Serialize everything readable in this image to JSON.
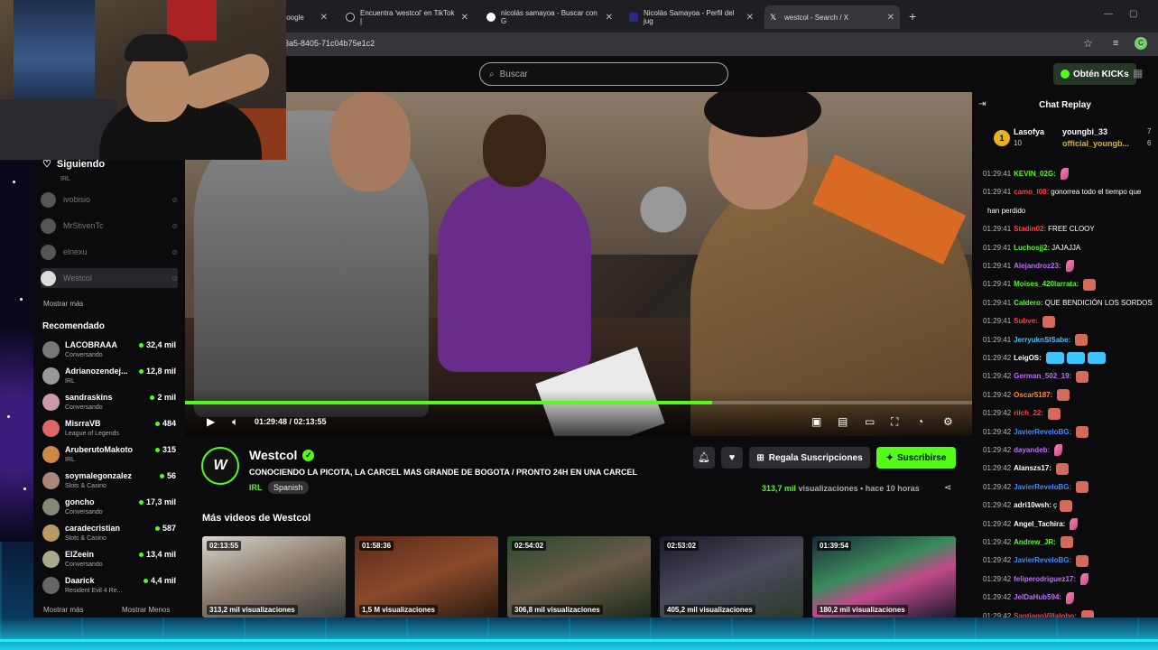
{
  "browser": {
    "tabs": [
      {
        "label": "Google",
        "close": "✕"
      },
      {
        "label": "Encuentra 'westcol' en TikTok |",
        "close": "✕"
      },
      {
        "label": "nicolás samayoa - Buscar con G",
        "close": "✕"
      },
      {
        "label": "Nicolás Samayoa - Perfil del jug",
        "close": "✕"
      },
      {
        "label": "westcol - Search / X",
        "close": "✕"
      }
    ],
    "new_tab": "+",
    "url": "3a5-8405-71c04b75e1c2",
    "profile_initial": "C"
  },
  "nav": {
    "search_placeholder": "Buscar",
    "kicks_label": "Obtén KICKs"
  },
  "sidebar": {
    "following_title": "Siguiendo",
    "following_sub": "IRL",
    "following": [
      {
        "name": "ivobisio"
      },
      {
        "name": "MrStivenTc"
      },
      {
        "name": "elnexu"
      },
      {
        "name": "Westcol"
      }
    ],
    "show_more": "Mostrar más",
    "recommended_title": "Recomendado",
    "recommended": [
      {
        "name": "LACOBRAAA",
        "category": "Conversando",
        "viewers": "32,4 mil"
      },
      {
        "name": "Adrianozendej...",
        "category": "IRL",
        "viewers": "12,8 mil"
      },
      {
        "name": "sandraskins",
        "category": "Conversando",
        "viewers": "2 mil"
      },
      {
        "name": "MisrraVB",
        "category": "League of Legends",
        "viewers": "484"
      },
      {
        "name": "AruberutoMakoto",
        "category": "IRL",
        "viewers": "315"
      },
      {
        "name": "soymalegonzalez",
        "category": "Slots & Casino",
        "viewers": "56"
      },
      {
        "name": "goncho",
        "category": "Conversando",
        "viewers": "17,3 mil"
      },
      {
        "name": "caradecristian",
        "category": "Slots & Casino",
        "viewers": "587"
      },
      {
        "name": "ElZeein",
        "category": "Conversando",
        "viewers": "13,4 mil"
      },
      {
        "name": "Daarick",
        "category": "Resident Evil 4 Re...",
        "viewers": "4,4 mil"
      }
    ],
    "footer_more": "Mostrar más",
    "footer_less": "Mostrar Menos"
  },
  "player": {
    "progress": 0.67,
    "time": "01:29:48 / 02:13:55"
  },
  "stream": {
    "channel": "Westcol",
    "avatar_text": "W",
    "title": "CONOCIENDO LA PICOTA, LA CARCEL MAS GRANDE DE BOGOTA / PRONTO 24H EN UNA CARCEL",
    "category": "IRL",
    "tag": "Spanish",
    "gift_label": "Regala Suscripciones",
    "subscribe_label": "Suscribirse",
    "views_count": "313,7 mil",
    "views_word": "visualizaciones",
    "ago": "hace 10 horas",
    "more_videos_title": "Más videos de Westcol",
    "videos": [
      {
        "duration": "02:13:55",
        "views": "313,2 mil visualizaciones"
      },
      {
        "duration": "01:58:36",
        "views": "1,5 M visualizaciones"
      },
      {
        "duration": "02:54:02",
        "views": "306,8 mil visualizaciones"
      },
      {
        "duration": "02:53:02",
        "views": "405,2 mil visualizaciones"
      },
      {
        "duration": "01:39:54",
        "views": "180,2 mil visualizaciones"
      }
    ]
  },
  "chat": {
    "title": "Chat Replay",
    "pinned": [
      {
        "name": "Lasofya",
        "count": "10"
      },
      {
        "name": "youngbi_33",
        "count": "7"
      },
      {
        "name": "official_youngb...",
        "count": "6"
      }
    ],
    "messages": [
      {
        "time": "01:29:41",
        "user": "KEVIN_02G:",
        "text": "",
        "color": "#53fc18"
      },
      {
        "time": "01:29:41",
        "user": "camo_l08:",
        "text": "gonorrea todo el tiempo que",
        "color": "#ff4040"
      },
      {
        "time": "",
        "user": "",
        "text": "han perdido",
        "color": "#ffffff"
      },
      {
        "time": "01:29:41",
        "user": "Stadin02:",
        "text": "FREE CLOOY",
        "color": "#ff4040"
      },
      {
        "time": "01:29:41",
        "user": "Luchosjj2:",
        "text": "JAJAJJA",
        "color": "#53fc18"
      },
      {
        "time": "01:29:41",
        "user": "Alejandroz23:",
        "text": "",
        "color": "#c06bff"
      },
      {
        "time": "01:29:41",
        "user": "Moises_420larrata:",
        "text": "",
        "color": "#53fc18"
      },
      {
        "time": "01:29:41",
        "user": "Caldero:",
        "text": "QUE BENDICIÓN LOS SORDOS",
        "color": "#53fc18"
      },
      {
        "time": "01:29:41",
        "user": "Subve:",
        "text": "",
        "color": "#ff4040"
      },
      {
        "time": "01:29:41",
        "user": "JerryuknSISabe:",
        "text": "",
        "color": "#3ec5ff"
      },
      {
        "time": "01:29:42",
        "user": "LeigOS:",
        "text": "",
        "color": "#ffffff"
      },
      {
        "time": "01:29:42",
        "user": "German_502_19:",
        "text": "",
        "color": "#c06bff"
      },
      {
        "time": "01:29:42",
        "user": "Oscar5187:",
        "text": "",
        "color": "#ff8a3d"
      },
      {
        "time": "01:29:42",
        "user": "rilch_22:",
        "text": "",
        "color": "#ff4040"
      },
      {
        "time": "01:29:42",
        "user": "JavierReveloBG:",
        "text": "",
        "color": "#3e8bff"
      },
      {
        "time": "01:29:42",
        "user": "dayandeb:",
        "text": "",
        "color": "#c06bff"
      },
      {
        "time": "01:29:42",
        "user": "Alanszs17:",
        "text": "",
        "color": "#ffffff"
      },
      {
        "time": "01:29:42",
        "user": "JavierReveloBG:",
        "text": "",
        "color": "#3e8bff"
      },
      {
        "time": "01:29:42",
        "user": "adri10wsh:",
        "text": "ç",
        "color": "#ffffff"
      },
      {
        "time": "01:29:42",
        "user": "Angel_Tachira:",
        "text": "",
        "color": "#ffffff"
      },
      {
        "time": "01:29:42",
        "user": "Andrew_JR:",
        "text": "",
        "color": "#53fc18"
      },
      {
        "time": "01:29:42",
        "user": "JavierReveloBG:",
        "text": "",
        "color": "#3e8bff"
      },
      {
        "time": "01:29:42",
        "user": "feliperodriguez17:",
        "text": "",
        "color": "#c06bff"
      },
      {
        "time": "01:29:42",
        "user": "JelDaHub594:",
        "text": "",
        "color": "#c06bff"
      },
      {
        "time": "01:29:42",
        "user": "SantiagoVillalobo:",
        "text": "",
        "color": "#ff4040"
      }
    ]
  },
  "colors": {
    "accent": "#53fc18",
    "background": "#0b0b0e"
  }
}
